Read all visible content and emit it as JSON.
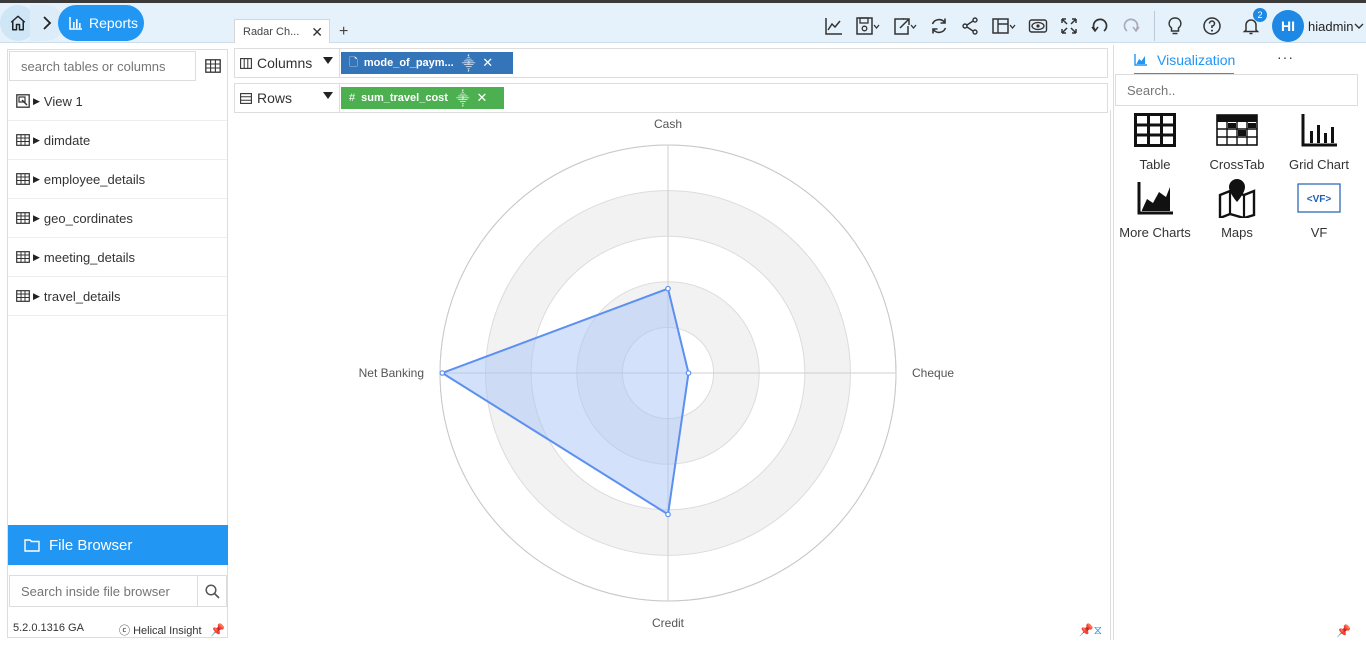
{
  "nav": {
    "reports_label": "Reports"
  },
  "tabs": [
    {
      "label": "Radar Ch..."
    }
  ],
  "user": {
    "initials": "HI",
    "name": "hiadmin",
    "notification_count": "2"
  },
  "left_panel": {
    "search_placeholder": "search tables or columns",
    "items": [
      {
        "label": "View 1"
      },
      {
        "label": "dimdate"
      },
      {
        "label": "employee_details"
      },
      {
        "label": "geo_cordinates"
      },
      {
        "label": "meeting_details"
      },
      {
        "label": "travel_details"
      }
    ],
    "file_browser_label": "File Browser",
    "file_search_placeholder": "Search inside file browser",
    "version": "5.2.0.1316 GA",
    "brand": "Helical Insight"
  },
  "shelves": {
    "columns_label": "Columns",
    "rows_label": "Rows",
    "columns_pill": "mode_of_paym...",
    "rows_pill": "sum_travel_cost"
  },
  "visualization": {
    "tab_label": "Visualization",
    "search_placeholder": "Search..",
    "items": [
      {
        "label": "Table",
        "icon": "table-icon"
      },
      {
        "label": "CrossTab",
        "icon": "crosstab-icon"
      },
      {
        "label": "Grid Chart",
        "icon": "grid-chart-icon"
      },
      {
        "label": "More Charts",
        "icon": "more-charts-icon"
      },
      {
        "label": "Maps",
        "icon": "maps-icon"
      },
      {
        "label": "VF",
        "icon": "vf-icon"
      }
    ]
  },
  "colors": {
    "accent": "#2196f3",
    "radar_stroke": "#5b8ff0",
    "radar_fill": "#a9c3f5",
    "pill_blue": "#3474b8",
    "pill_green": "#4caf50"
  },
  "chart_data": {
    "type": "radar",
    "categories": [
      "Cash",
      "Cheque",
      "Credit",
      "Net Banking"
    ],
    "values": [
      0.37,
      0.09,
      0.62,
      0.99
    ],
    "rmax": 1,
    "rings": 5,
    "grid": true
  }
}
